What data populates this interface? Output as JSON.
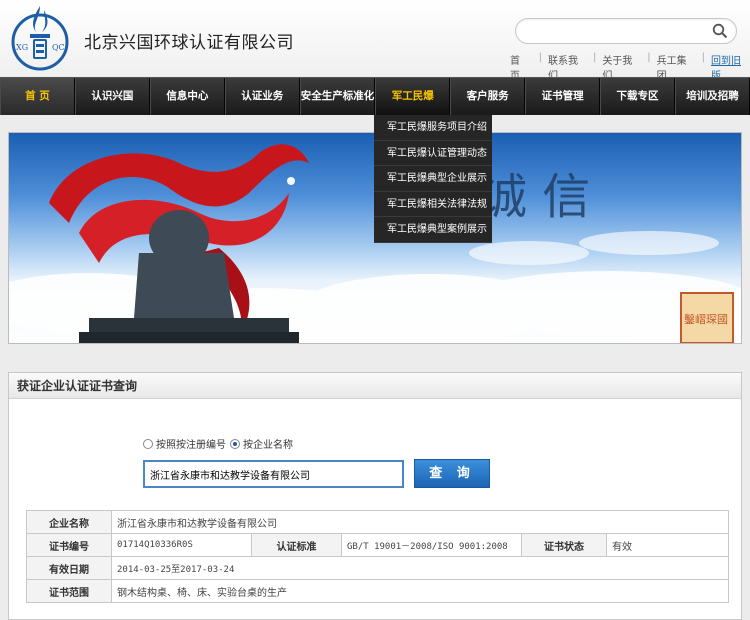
{
  "header": {
    "company_name": "北京兴国环球认证有限公司",
    "logo_text_left": "XG",
    "logo_text_right": "QC",
    "search_placeholder": "",
    "toplinks": [
      "首 页",
      "联系我们",
      "关于我们",
      "兵工集团",
      "回到旧版"
    ]
  },
  "nav": {
    "items": [
      "首 页",
      "认识兴国",
      "信息中心",
      "认证业务",
      "安全生产标准化",
      "军工民爆",
      "客户服务",
      "证书管理",
      "下载专区",
      "培训及招聘"
    ],
    "active_index": 0,
    "hover_index": 5
  },
  "dropdown": {
    "items": [
      "军工民爆服务项目介绍",
      "军工民爆认证管理动态",
      "军工民爆典型企业展示",
      "军工民爆相关法律法规",
      "军工民爆典型案例展示"
    ]
  },
  "banner": {
    "calligraphy": "诚 信",
    "seal_text": "鑿嶍琛國"
  },
  "panel": {
    "title": "获证企业认证证书查询",
    "radio_option_1": "按照按注册编号",
    "radio_option_2": "按企业名称",
    "radio_selected": 2,
    "query_value": "浙江省永康市和达教学设备有限公司",
    "query_button": "查 询"
  },
  "result": {
    "company_label": "企业名称",
    "company_value": "浙江省永康市和达教学设备有限公司",
    "cert_no_label": "证书编号",
    "cert_no_value": "01714Q10336R0S",
    "standard_label": "认证标准",
    "standard_value": "GB/T 19001－2008/ISO 9001:2008",
    "status_label": "证书状态",
    "status_value": "有效",
    "validity_label": "有效日期",
    "validity_value": "2014-03-25至2017-03-24",
    "scope_label": "证书范围",
    "scope_value": "钢木结构桌、椅、床、实验台桌的生产"
  },
  "colors": {
    "nav_bg": "#222222",
    "nav_active_text": "#f5c400",
    "button_blue": "#2a78c8",
    "logo_blue": "#1d5fa6"
  }
}
